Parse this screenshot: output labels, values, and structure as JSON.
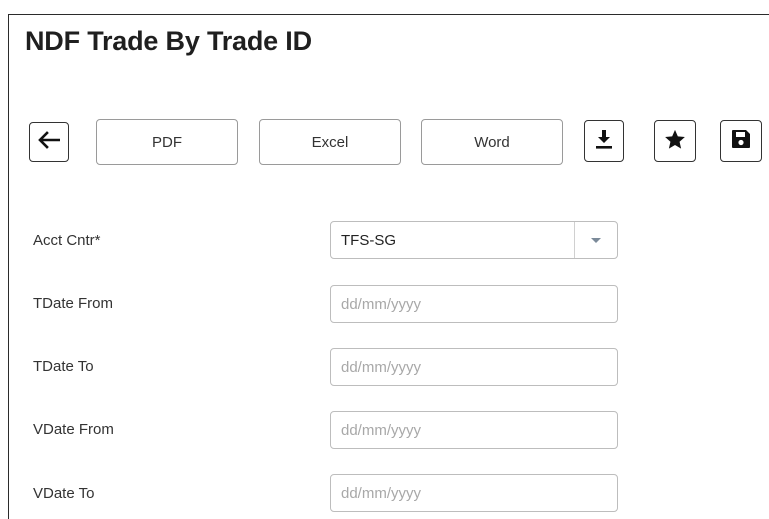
{
  "page": {
    "title": "NDF Trade By Trade ID"
  },
  "toolbar": {
    "pdf_label": "PDF",
    "excel_label": "Excel",
    "word_label": "Word"
  },
  "form": {
    "acct_cntr": {
      "label": "Acct Cntr*",
      "value": "TFS-SG"
    },
    "tdate_from": {
      "label": "TDate From",
      "placeholder": "dd/mm/yyyy"
    },
    "tdate_to": {
      "label": "TDate To",
      "placeholder": "dd/mm/yyyy"
    },
    "vdate_from": {
      "label": "VDate From",
      "placeholder": "dd/mm/yyyy"
    },
    "vdate_to": {
      "label": "VDate To",
      "placeholder": "dd/mm/yyyy"
    }
  },
  "icons": {
    "back": "arrow-left-icon",
    "download": "download-icon",
    "favorite": "star-icon",
    "save": "save-icon",
    "dropdown": "caret-down-icon"
  }
}
